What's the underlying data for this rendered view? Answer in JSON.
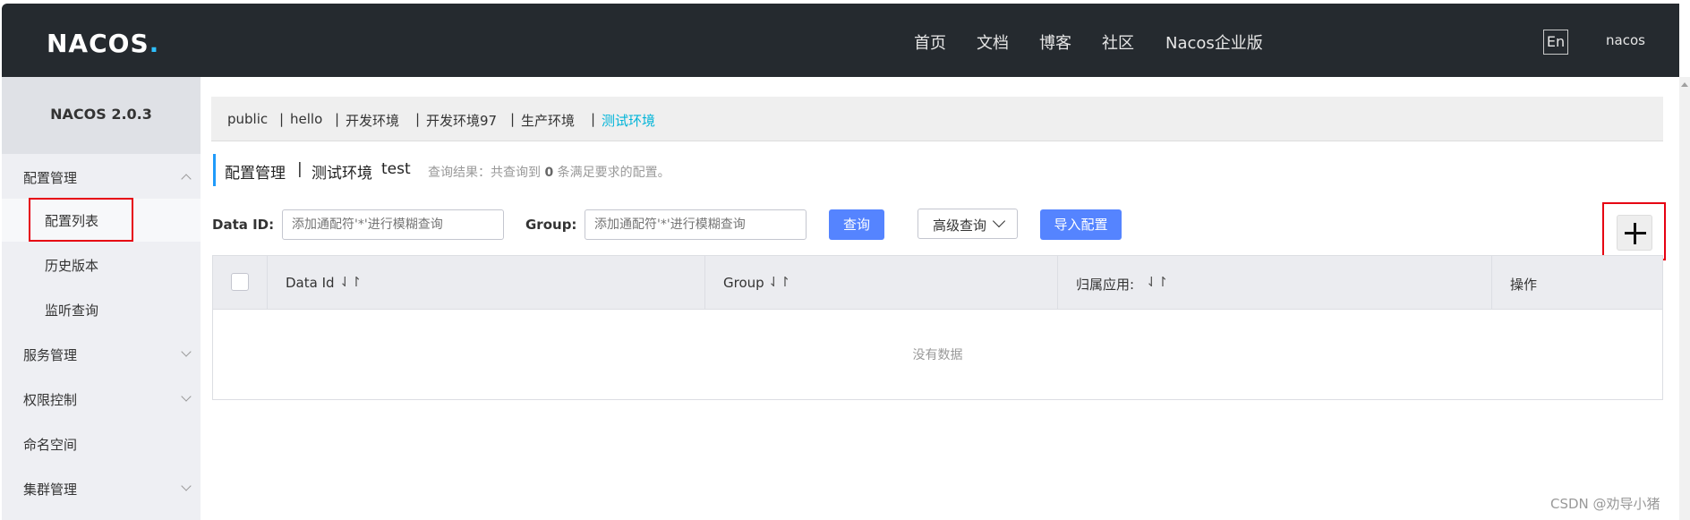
{
  "header": {
    "logo": "NACOS",
    "logo_dot": ".",
    "nav": [
      "首页",
      "文档",
      "博客",
      "社区",
      "Nacos企业版"
    ],
    "lang": "En",
    "user": "nacos"
  },
  "sidebar": {
    "title": "NACOS 2.0.3",
    "groups": [
      {
        "label": "配置管理",
        "expanded": true
      },
      {
        "label": "服务管理"
      },
      {
        "label": "权限控制"
      },
      {
        "label": "命名空间"
      },
      {
        "label": "集群管理"
      }
    ],
    "sub_items": [
      "配置列表",
      "历史版本",
      "监听查询"
    ]
  },
  "namespaces": {
    "items": [
      "public",
      "hello",
      "开发环境",
      "开发环境97",
      "生产环境",
      "测试环境"
    ],
    "sep": "|",
    "active_index": 5
  },
  "page_header": {
    "title": "配置管理",
    "sep": "|",
    "namespace": "测试环境",
    "namespace_id": "test",
    "result_prefix": "查询结果：共查询到",
    "result_count": "0",
    "result_suffix": "条满足要求的配置。"
  },
  "filters": {
    "data_id_label": "Data ID:",
    "data_id_placeholder": "添加通配符'*'进行模糊查询",
    "group_label": "Group:",
    "group_placeholder": "添加通配符'*'进行模糊查询",
    "query_button": "查询",
    "advanced_button": "高级查询",
    "import_button": "导入配置"
  },
  "table": {
    "columns": [
      "Data Id",
      "Group",
      "归属应用:",
      "操作"
    ],
    "sort_icon": "⇃↾",
    "empty_text": "没有数据"
  },
  "watermark": "CSDN @劝导小猪",
  "colors": {
    "topbar": "#252a2f",
    "primary": "#5584ff",
    "active_ns": "#00b4d8",
    "highlight": "#e60012"
  }
}
